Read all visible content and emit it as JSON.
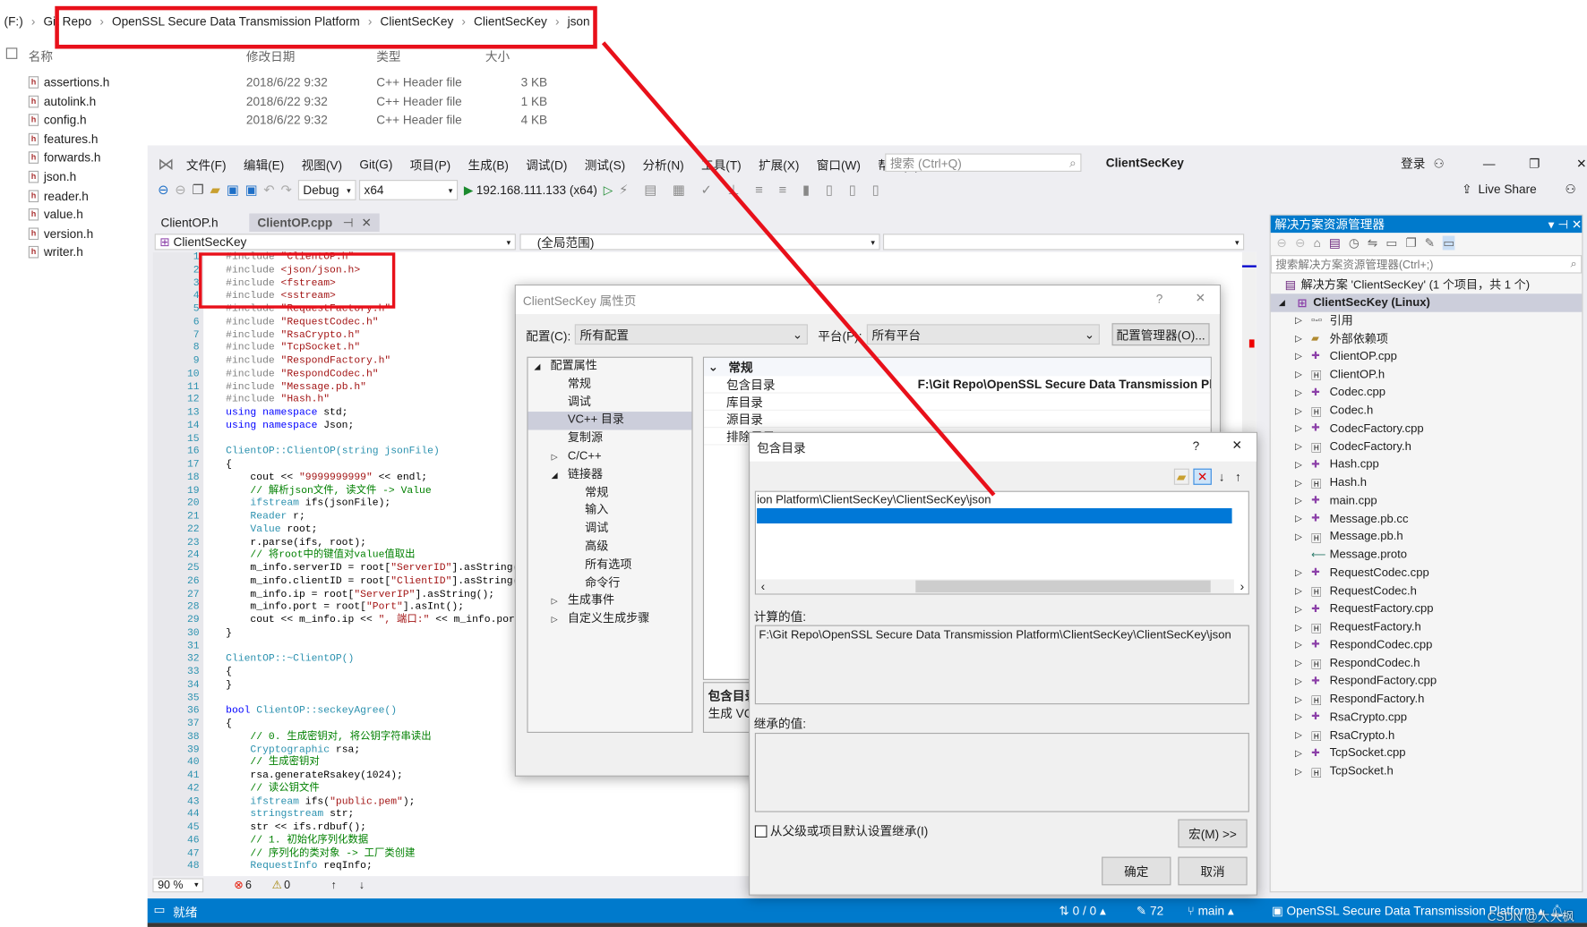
{
  "explorer": {
    "breadcrumb": [
      "(F:)",
      "Git Repo",
      "OpenSSL Secure Data Transmission Platform",
      "ClientSecKey",
      "ClientSecKey",
      "json"
    ],
    "columns": [
      "名称",
      "修改日期",
      "类型",
      "大小"
    ],
    "files": [
      {
        "name": "assertions.h",
        "date": "2018/6/22 9:32",
        "type": "C++ Header file",
        "size": "3 KB"
      },
      {
        "name": "autolink.h",
        "date": "2018/6/22 9:32",
        "type": "C++ Header file",
        "size": "1 KB"
      },
      {
        "name": "config.h",
        "date": "2018/6/22 9:32",
        "type": "C++ Header file",
        "size": "4 KB"
      },
      {
        "name": "features.h"
      },
      {
        "name": "forwards.h"
      },
      {
        "name": "json.h"
      },
      {
        "name": "reader.h"
      },
      {
        "name": "value.h"
      },
      {
        "name": "version.h"
      },
      {
        "name": "writer.h"
      }
    ]
  },
  "vs": {
    "menu": [
      "文件(F)",
      "编辑(E)",
      "视图(V)",
      "Git(G)",
      "项目(P)",
      "生成(B)",
      "调试(D)",
      "测试(S)",
      "分析(N)",
      "工具(T)",
      "扩展(X)",
      "窗口(W)",
      "帮助(H)"
    ],
    "search_placeholder": "搜索 (Ctrl+Q)",
    "title": "ClientSecKey",
    "login": "登录",
    "live_share": "Live Share",
    "config": "Debug",
    "platform": "x64",
    "run_target": "192.168.111.133 (x64)",
    "tabs": [
      "ClientOP.h",
      "ClientOP.cpp"
    ],
    "nav_project": "ClientSecKey",
    "nav_scope": "(全局范围)",
    "zoom": "90 %",
    "errors": "6",
    "warnings": "0",
    "code": [
      [
        [
          "#include ",
          "pp"
        ],
        [
          "\"ClientOP.h\"",
          "str"
        ]
      ],
      [
        [
          "#include ",
          "pp"
        ],
        [
          "<json/json.h>",
          "str"
        ]
      ],
      [
        [
          "#include ",
          "pp"
        ],
        [
          "<fstream>",
          "str"
        ]
      ],
      [
        [
          "#include ",
          "pp"
        ],
        [
          "<sstream>",
          "str"
        ]
      ],
      [
        [
          "#include ",
          "pp"
        ],
        [
          "\"RequestFactory.h\"",
          "str"
        ]
      ],
      [
        [
          "#include ",
          "pp"
        ],
        [
          "\"RequestCodec.h\"",
          "str"
        ]
      ],
      [
        [
          "#include ",
          "pp"
        ],
        [
          "\"RsaCrypto.h\"",
          "str"
        ]
      ],
      [
        [
          "#include ",
          "pp"
        ],
        [
          "\"TcpSocket.h\"",
          "str"
        ]
      ],
      [
        [
          "#include ",
          "pp"
        ],
        [
          "\"RespondFactory.h\"",
          "str"
        ]
      ],
      [
        [
          "#include ",
          "pp"
        ],
        [
          "\"RespondCodec.h\"",
          "str"
        ]
      ],
      [
        [
          "#include ",
          "pp"
        ],
        [
          "\"Message.pb.h\"",
          "str"
        ]
      ],
      [
        [
          "#include ",
          "pp"
        ],
        [
          "\"Hash.h\"",
          "str"
        ]
      ],
      [
        [
          "using namespace ",
          "kw"
        ],
        [
          "std;",
          "tx"
        ]
      ],
      [
        [
          "using namespace ",
          "kw"
        ],
        [
          "Json;",
          "tx"
        ]
      ],
      [],
      [
        [
          "ClientOP::ClientOP(",
          "ty"
        ],
        [
          "string jsonFile)",
          "ty"
        ]
      ],
      [
        [
          "{",
          "tx"
        ]
      ],
      [
        [
          "    cout << ",
          "tx"
        ],
        [
          "\"9999999999\"",
          "str"
        ],
        [
          " << endl;",
          "tx"
        ]
      ],
      [
        [
          "    // 解析json文件, 读文件 -> Value",
          "cm"
        ]
      ],
      [
        [
          "    ifstream ",
          "ty"
        ],
        [
          "ifs(jsonFile);",
          "tx"
        ]
      ],
      [
        [
          "    Reader ",
          "ty"
        ],
        [
          "r;",
          "tx"
        ]
      ],
      [
        [
          "    Value ",
          "ty"
        ],
        [
          "root;",
          "tx"
        ]
      ],
      [
        [
          "    r.parse(ifs, root);",
          "tx"
        ]
      ],
      [
        [
          "    // 将root中的键值对value值取出",
          "cm"
        ]
      ],
      [
        [
          "    m_info.serverID = root[",
          "tx"
        ],
        [
          "\"ServerID\"",
          "str"
        ],
        [
          "].asString();",
          "tx"
        ]
      ],
      [
        [
          "    m_info.clientID = root[",
          "tx"
        ],
        [
          "\"ClientID\"",
          "str"
        ],
        [
          "].asString();",
          "tx"
        ]
      ],
      [
        [
          "    m_info.ip = root[",
          "tx"
        ],
        [
          "\"ServerIP\"",
          "str"
        ],
        [
          "].asString();",
          "tx"
        ]
      ],
      [
        [
          "    m_info.port = root[",
          "tx"
        ],
        [
          "\"Port\"",
          "str"
        ],
        [
          "].asInt();",
          "tx"
        ]
      ],
      [
        [
          "    cout << m_info.ip << ",
          "tx"
        ],
        [
          "\", 端口:\"",
          "str"
        ],
        [
          " << m_info.port << en",
          "tx"
        ]
      ],
      [
        [
          "}",
          "tx"
        ]
      ],
      [],
      [
        [
          "ClientOP::~ClientOP()",
          "ty"
        ]
      ],
      [
        [
          "{",
          "tx"
        ]
      ],
      [
        [
          "}",
          "tx"
        ]
      ],
      [],
      [
        [
          "bool ",
          "kw"
        ],
        [
          "ClientOP::seckeyAgree()",
          "ty"
        ]
      ],
      [
        [
          "{",
          "tx"
        ]
      ],
      [
        [
          "    // 0. 生成密钥对, 将公钥字符串读出",
          "cm"
        ]
      ],
      [
        [
          "    Cryptographic ",
          "ty"
        ],
        [
          "rsa;",
          "tx"
        ]
      ],
      [
        [
          "    // 生成密钥对",
          "cm"
        ]
      ],
      [
        [
          "    rsa.generateRsakey(1024);",
          "tx"
        ]
      ],
      [
        [
          "    // 读公钥文件",
          "cm"
        ]
      ],
      [
        [
          "    ifstream ",
          "ty"
        ],
        [
          "ifs(",
          "tx"
        ],
        [
          "\"public.pem\"",
          "str"
        ],
        [
          ");",
          "tx"
        ]
      ],
      [
        [
          "    stringstream ",
          "ty"
        ],
        [
          "str;",
          "tx"
        ]
      ],
      [
        [
          "    str << ifs.rdbuf();",
          "tx"
        ]
      ],
      [
        [
          "    // 1. 初始化序列化数据",
          "cm"
        ]
      ],
      [
        [
          "    // 序列化的类对象 -> 工厂类创建",
          "cm"
        ]
      ],
      [
        [
          "    RequestInfo ",
          "ty"
        ],
        [
          "reqInfo;",
          "tx"
        ]
      ]
    ],
    "status": {
      "ready": "就绪",
      "sync": "0 / 0",
      "edits": "72",
      "branch": "main",
      "repo": "OpenSSL Secure Data Transmission Platform"
    }
  },
  "solution_explorer": {
    "title": "解决方案资源管理器",
    "search_placeholder": "搜索解决方案资源管理器(Ctrl+;)",
    "solution": "解决方案 'ClientSecKey' (1 个项目，共 1 个)",
    "project": "ClientSecKey (Linux)",
    "items": [
      {
        "label": "引用",
        "icon": "reference"
      },
      {
        "label": "外部依赖项",
        "icon": "folder"
      },
      {
        "label": "ClientOP.cpp",
        "icon": "cpp"
      },
      {
        "label": "ClientOP.h",
        "icon": "h"
      },
      {
        "label": "Codec.cpp",
        "icon": "cpp"
      },
      {
        "label": "Codec.h",
        "icon": "h"
      },
      {
        "label": "CodecFactory.cpp",
        "icon": "cpp"
      },
      {
        "label": "CodecFactory.h",
        "icon": "h"
      },
      {
        "label": "Hash.cpp",
        "icon": "cpp"
      },
      {
        "label": "Hash.h",
        "icon": "h"
      },
      {
        "label": "main.cpp",
        "icon": "cpp"
      },
      {
        "label": "Message.pb.cc",
        "icon": "cpp"
      },
      {
        "label": "Message.pb.h",
        "icon": "h"
      },
      {
        "label": "Message.proto",
        "icon": "proto"
      },
      {
        "label": "RequestCodec.cpp",
        "icon": "cpp"
      },
      {
        "label": "RequestCodec.h",
        "icon": "h"
      },
      {
        "label": "RequestFactory.cpp",
        "icon": "cpp"
      },
      {
        "label": "RequestFactory.h",
        "icon": "h"
      },
      {
        "label": "RespondCodec.cpp",
        "icon": "cpp"
      },
      {
        "label": "RespondCodec.h",
        "icon": "h"
      },
      {
        "label": "RespondFactory.cpp",
        "icon": "cpp"
      },
      {
        "label": "RespondFactory.h",
        "icon": "h"
      },
      {
        "label": "RsaCrypto.cpp",
        "icon": "cpp"
      },
      {
        "label": "RsaCrypto.h",
        "icon": "h"
      },
      {
        "label": "TcpSocket.cpp",
        "icon": "cpp"
      },
      {
        "label": "TcpSocket.h",
        "icon": "h"
      }
    ]
  },
  "props": {
    "title": "ClientSecKey 属性页",
    "config_label": "配置(C):",
    "config_value": "所有配置",
    "platform_label": "平台(P):",
    "platform_value": "所有平台",
    "config_manager": "配置管理器(O)...",
    "tree": [
      {
        "label": "配置属性",
        "level": 0,
        "arrow": "◢"
      },
      {
        "label": "常规",
        "level": 1
      },
      {
        "label": "调试",
        "level": 1
      },
      {
        "label": "VC++ 目录",
        "level": 1,
        "selected": true
      },
      {
        "label": "复制源",
        "level": 1
      },
      {
        "label": "C/C++",
        "level": 1,
        "arrow": "▷"
      },
      {
        "label": "链接器",
        "level": 1,
        "arrow": "◢"
      },
      {
        "label": "常规",
        "level": 2
      },
      {
        "label": "输入",
        "level": 2
      },
      {
        "label": "调试",
        "level": 2
      },
      {
        "label": "高级",
        "level": 2
      },
      {
        "label": "所有选项",
        "level": 2
      },
      {
        "label": "命令行",
        "level": 2
      },
      {
        "label": "生成事件",
        "level": 1,
        "arrow": "▷"
      },
      {
        "label": "自定义生成步骤",
        "level": 1,
        "arrow": "▷"
      }
    ],
    "section": "常规",
    "rows": [
      {
        "name": "包含目录",
        "value": "F:\\Git Repo\\OpenSSL Secure Data Transmission Platf"
      },
      {
        "name": "库目录"
      },
      {
        "name": "源目录"
      },
      {
        "name": "排除目录"
      }
    ],
    "desc_title": "包含目录",
    "desc_text": "生成 VC++"
  },
  "include_dlg": {
    "title": "包含目录",
    "entry": "ion Platform\\ClientSecKey\\ClientSecKey\\json",
    "computed_label": "计算的值:",
    "computed_value": "F:\\Git Repo\\OpenSSL Secure Data Transmission Platform\\ClientSecKey\\ClientSecKey\\json",
    "inherited_label": "继承的值:",
    "inherit_checkbox": "从父级或项目默认设置继承(I)",
    "inherit_checked": false,
    "macros": "宏(M) >>",
    "ok": "确定",
    "cancel": "取消"
  },
  "watermark": "CSDN @大大枫",
  "colors": {
    "accent": "#007acc",
    "annotation": "#e8101a",
    "selection": "#0078d7"
  }
}
